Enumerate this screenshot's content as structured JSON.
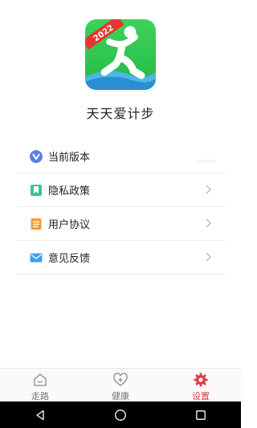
{
  "app": {
    "name": "天天爱计步",
    "logo_badge": "2022",
    "logo_color": "#2ec94f"
  },
  "menu": {
    "items": [
      {
        "label": "当前版本",
        "icon": "v-icon",
        "icon_color": "#5b7fe6"
      },
      {
        "label": "隐私政策",
        "icon": "bookmark-icon",
        "icon_color": "#3cc48a"
      },
      {
        "label": "用户协议",
        "icon": "document-icon",
        "icon_color": "#f39a2b"
      },
      {
        "label": "意见反馈",
        "icon": "mail-icon",
        "icon_color": "#3aa0e8"
      }
    ]
  },
  "tabbar": {
    "tabs": [
      {
        "label": "走路",
        "icon": "home-icon"
      },
      {
        "label": "健康",
        "icon": "health-heart-icon"
      },
      {
        "label": "设置",
        "icon": "gear-icon",
        "active": true
      }
    ],
    "active_color": "#e23b45"
  },
  "system_nav": {
    "buttons": [
      "back-icon",
      "home-circle-icon",
      "recents-icon"
    ]
  }
}
